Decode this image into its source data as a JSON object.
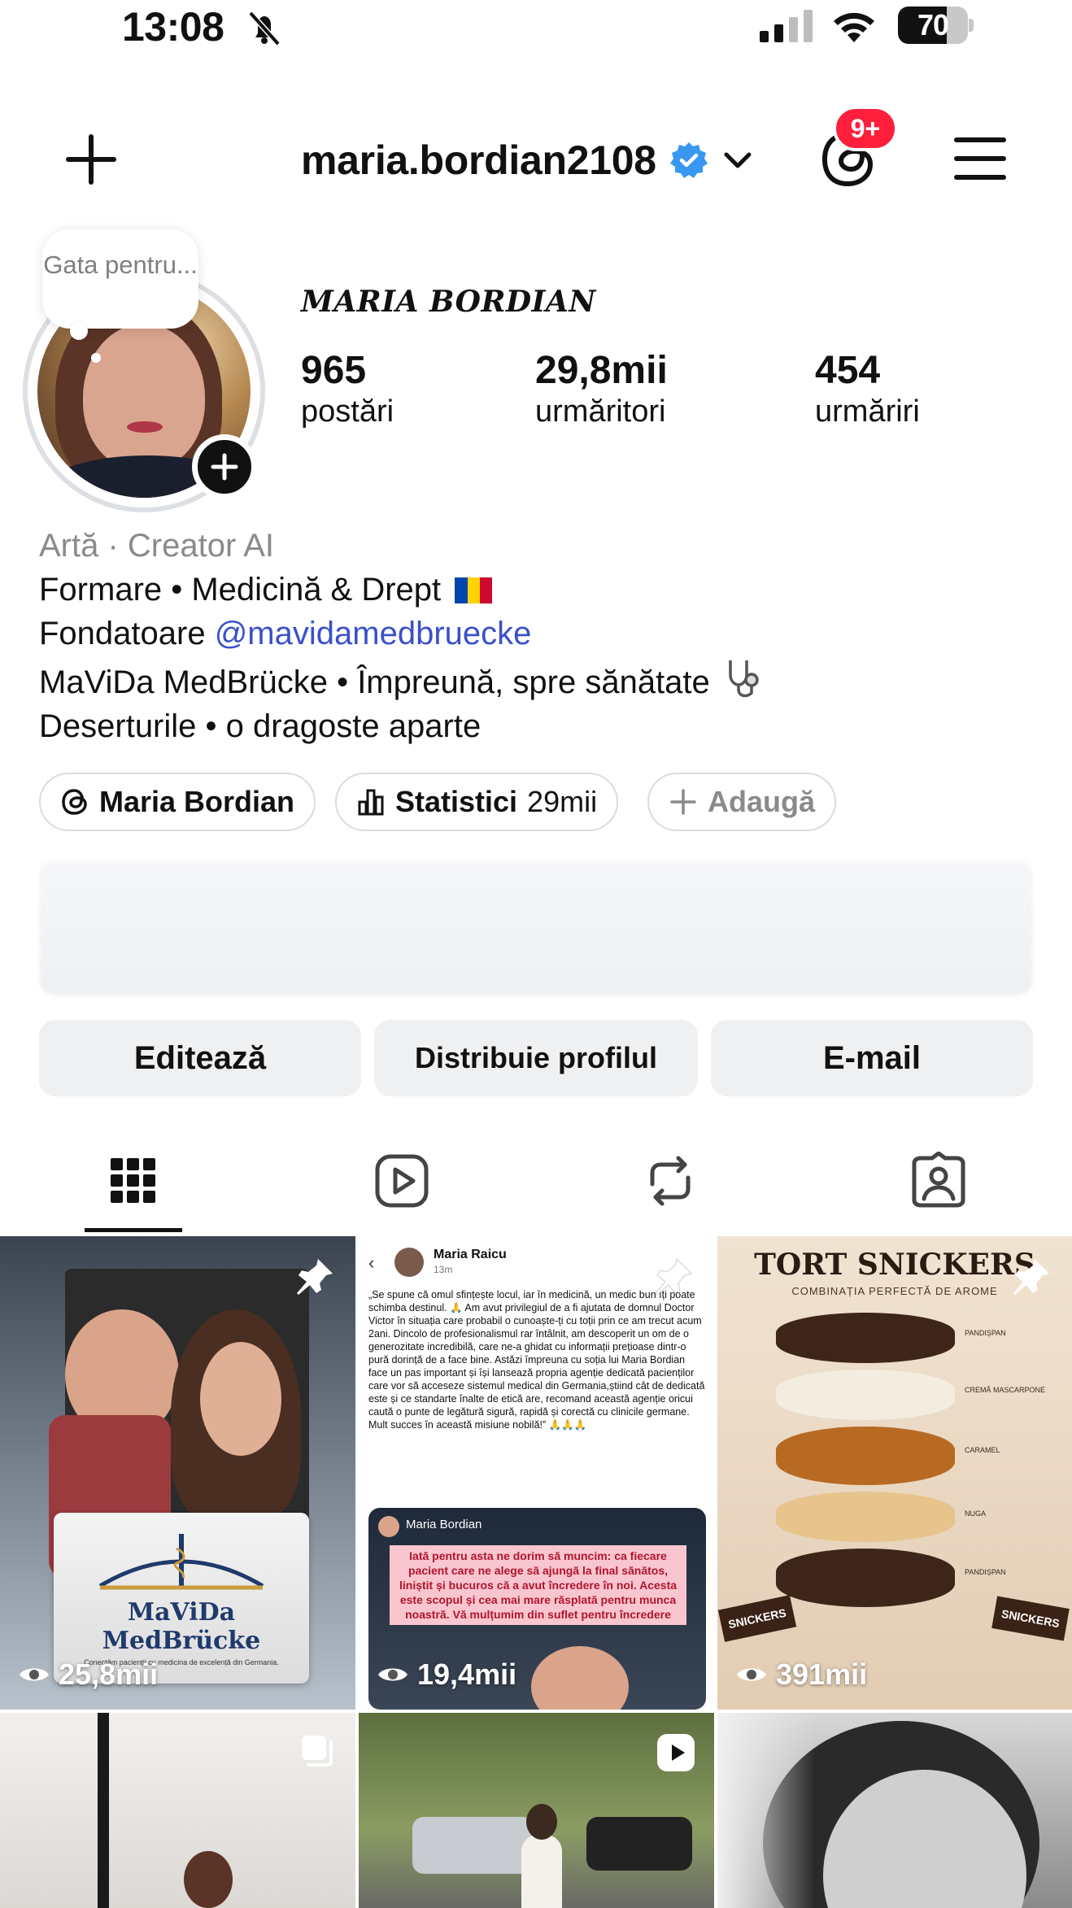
{
  "status_bar": {
    "time": "13:08",
    "battery": "70",
    "battery_level": 0.7
  },
  "header": {
    "username": "maria.bordian2108",
    "threads_badge": "9+"
  },
  "profile": {
    "note": "Gata pentru...",
    "display_name": "MARIA BORDIAN",
    "stats": [
      {
        "num": "965",
        "label": "postări"
      },
      {
        "num": "29,8mii",
        "label": "urmăritori"
      },
      {
        "num": "454",
        "label": "urmăriri"
      }
    ]
  },
  "bio": {
    "category": "Artă · Creator AI",
    "line1": "Formare • Medicină & Drept",
    "line2_prefix": "Fondatoare ",
    "line2_mention": "@mavidamedbruecke",
    "line3": "MaViDa MedBrücke • Împreună, spre sănătate",
    "line4": "Deserturile • o dragoste aparte"
  },
  "pills": {
    "threads_name": "Maria Bordian",
    "stats_label": "Statistici",
    "stats_value": "29mii",
    "add_label": "Adaugă"
  },
  "actions": {
    "edit": "Editează",
    "share": "Distribuie profilul",
    "email": "E-mail"
  },
  "posts": [
    {
      "views": "25,8mii",
      "logo_text": "MaViDa MedBrücke",
      "logo_sub": "Conectăm pacienții cu medicina de excelență din Germania."
    },
    {
      "views": "19,4mii",
      "author": "Maria Raicu",
      "meta": "13m",
      "quote": "„Se spune că omul sfințește locul, iar în medicină, un medic bun îți poate schimba destinul. 🙏 Am avut privilegiul de a fi ajutata de domnul Doctor Victor în situația care probabil o cunoaște-ți cu toții prin ce am trecut acum 2ani. Dincolo de profesionalismul rar întâlnit, am descoperit un om de o generozitate incredibilă, care ne-a ghidat cu informații prețioase dintr-o pură dorință de a face bine. Astăzi împreuna cu soția lui Maria Bordian face un pas important și își lansează propria agenție dedicată pacienților care vor să acceseze sistemul medical din Germania,știind cât de dedicată este și ce standarte înalte de etică are, recomand această agenție oricui caută o punte de legătură sigură, rapidă și corectă cu clinicile germane. Mult succes în această misiune nobilă!” 🙏🙏🙏",
      "reply_author": "Maria Bordian",
      "reply_text": "Iată pentru asta ne dorim să muncim: ca fiecare pacient care ne alege să ajungă la final sănătos, liniștit și bucuros că a avut încredere în noi. Acesta este scopul și cea mai mare răsplată pentru munca noastră. Vă mulțumim din suflet pentru încredere"
    },
    {
      "views": "391mii",
      "title": "TORT SNICKERS",
      "subtitle": "COMBINAȚIA PERFECTĂ DE AROME",
      "layers": [
        "PANDIȘPAN",
        "CREMĂ MASCARPONE",
        "CARAMEL",
        "NUGA",
        "PANDIȘPAN"
      ],
      "wrapper_label": "SNICKERS"
    }
  ],
  "colors": {
    "verified": "#3897f0",
    "badge": "#ff1f3d",
    "mention": "#3a50c9",
    "button_bg": "#eff0f2"
  },
  "icons": [
    "plus-icon",
    "verified-icon",
    "chevron-down-icon",
    "threads-icon",
    "menu-icon",
    "grid-icon",
    "reels-icon",
    "reposts-icon",
    "tagged-icon",
    "eye-icon",
    "pin-icon",
    "carousel-icon",
    "reel-icon"
  ]
}
